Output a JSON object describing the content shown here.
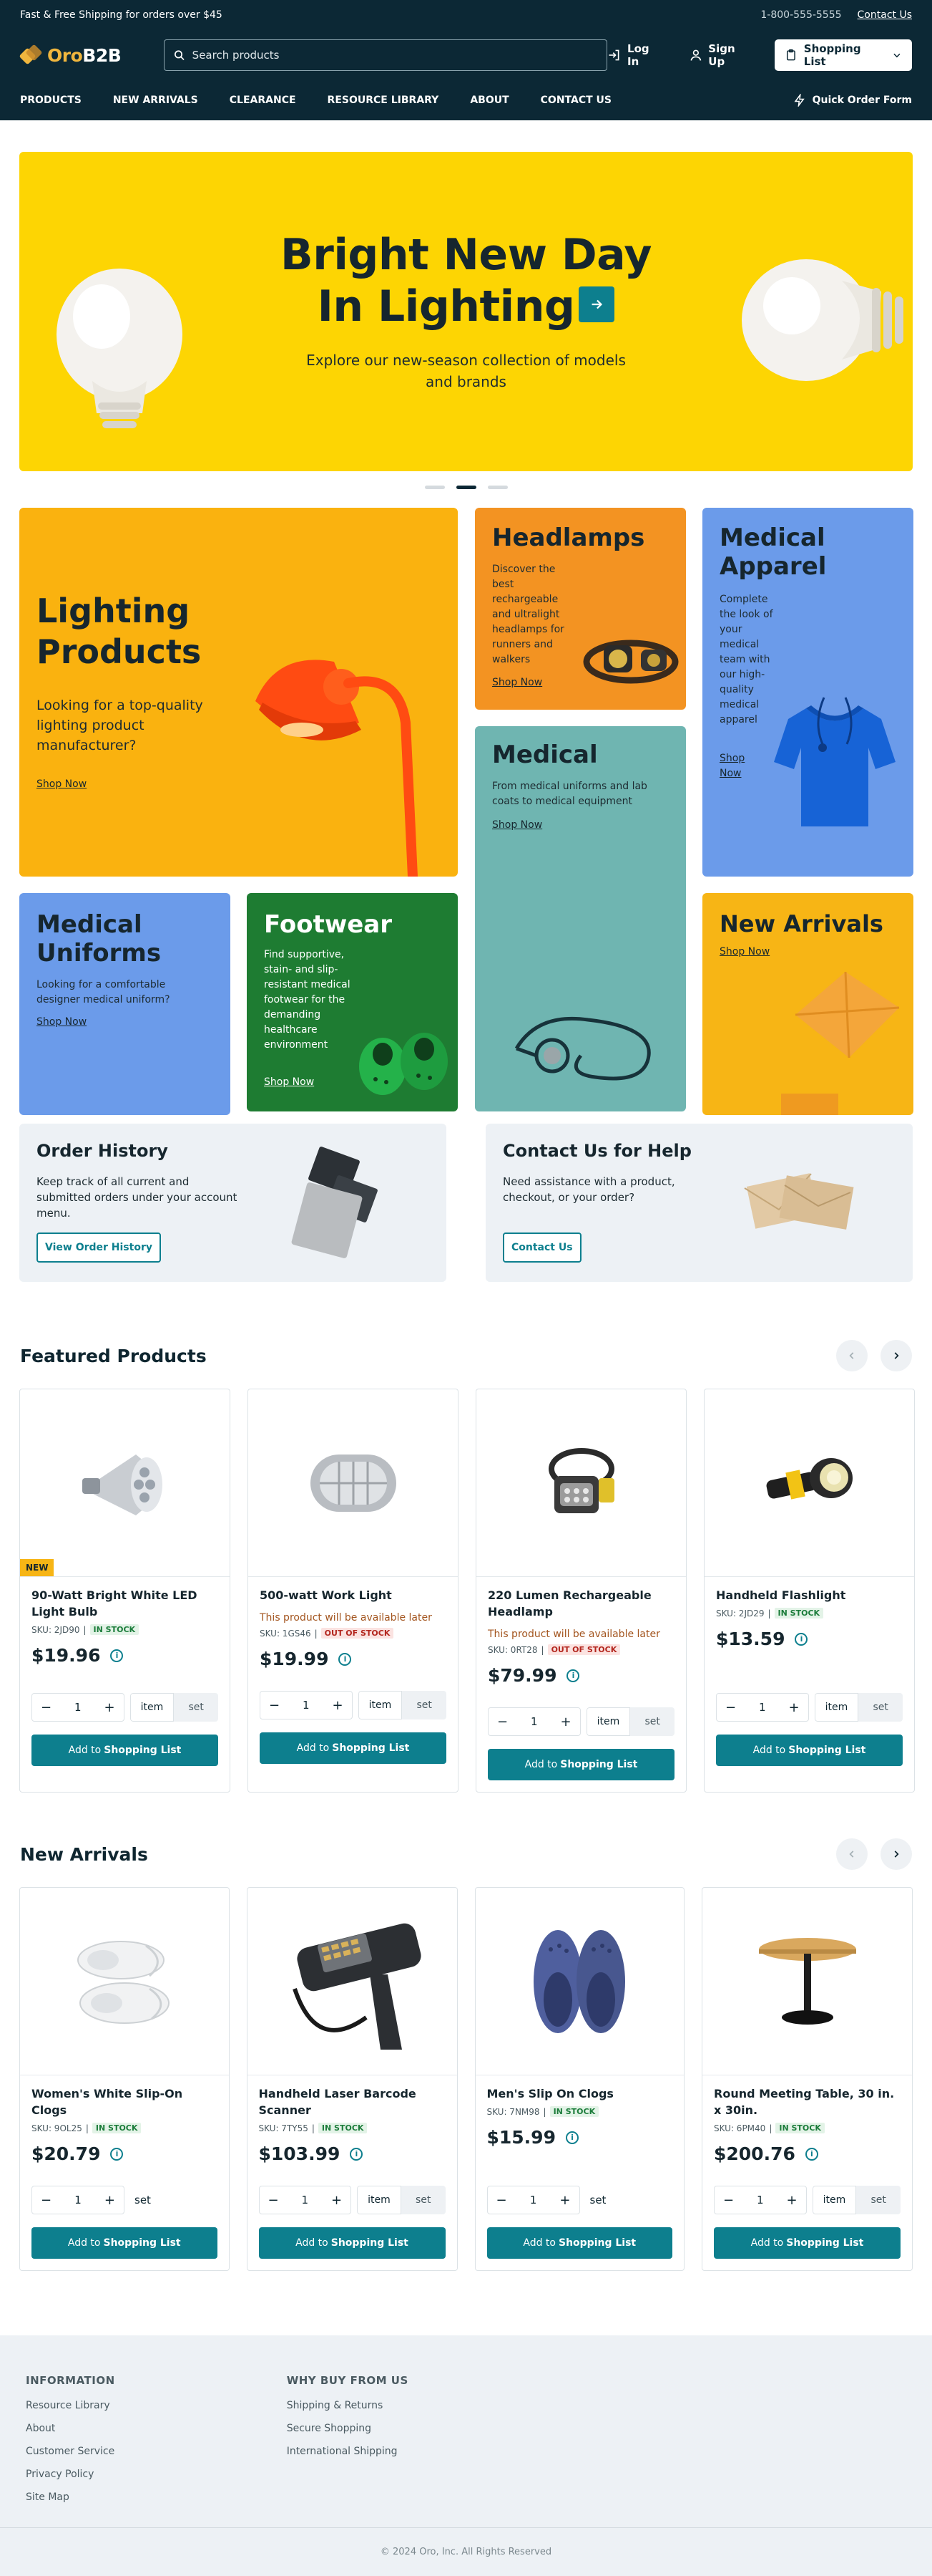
{
  "topbar": {
    "promo": "Fast & Free Shipping for orders over $45",
    "phone": "1-800-555-5555",
    "contact": "Contact Us"
  },
  "header": {
    "logo_prefix": "Oro",
    "logo_suffix": "B2B",
    "search_placeholder": "Search products",
    "login": "Log In",
    "signup": "Sign Up",
    "shopping_list": "Shopping List"
  },
  "nav": {
    "items": [
      "PRODUCTS",
      "NEW ARRIVALS",
      "CLEARANCE",
      "RESOURCE LIBRARY",
      "ABOUT",
      "CONTACT US"
    ],
    "quick_order": "Quick Order Form"
  },
  "hero": {
    "title_line1": "Bright New Day",
    "title_line2": "In Lighting",
    "subtitle_line1": "Explore our new-season collection of models",
    "subtitle_line2": "and brands"
  },
  "categories": {
    "lighting": {
      "title_line1": "Lighting",
      "title_line2": "Products",
      "text": "Looking for a top-quality lighting product manufacturer?",
      "cta": "Shop Now"
    },
    "headlamps": {
      "title": "Headlamps",
      "text": "Discover the best rechargeable and ultralight headlamps for runners and walkers",
      "cta": "Shop Now"
    },
    "medical_apparel": {
      "title_line1": "Medical",
      "title_line2": "Apparel",
      "text": "Complete the look of your medical team with our high-quality medical apparel",
      "cta": "Shop Now"
    },
    "medical": {
      "title": "Medical",
      "text": "From medical uniforms and lab coats to medical equipment",
      "cta": "Shop Now"
    },
    "medical_uniforms": {
      "title_line1": "Medical",
      "title_line2": "Uniforms",
      "text": "Looking for a comfortable designer medical uniform?",
      "cta": "Shop Now"
    },
    "footwear": {
      "title": "Footwear",
      "text": "Find supportive, stain- and slip-resistant medical footwear for the demanding healthcare environment",
      "cta": "Shop Now"
    },
    "new_arrivals": {
      "title": "New Arrivals",
      "cta": "Shop Now"
    }
  },
  "order_history": {
    "title": "Order History",
    "text": "Keep track of all current and submitted orders under your account menu.",
    "button": "View Order History"
  },
  "contact_help": {
    "title": "Contact Us for Help",
    "text": "Need assistance with a product, checkout, or your order?",
    "button": "Contact Us"
  },
  "featured": {
    "title": "Featured Products",
    "products": [
      {
        "name": "90-Watt Bright White LED Light Bulb",
        "sku": "SKU: 2JD90",
        "stock": "IN STOCK",
        "price": "$19.96",
        "availability": "",
        "badge": "NEW",
        "qty": "1",
        "unit1": "item",
        "unit2": "set"
      },
      {
        "name": "500-watt Work Light",
        "sku": "SKU: 1GS46",
        "stock": "OUT OF STOCK",
        "price": "$19.99",
        "availability": "This product will be available later",
        "badge": "",
        "qty": "1",
        "unit1": "item",
        "unit2": "set"
      },
      {
        "name": "220 Lumen Rechargeable Headlamp",
        "sku": "SKU: 0RT28",
        "stock": "OUT OF STOCK",
        "price": "$79.99",
        "availability": "This product will be available later",
        "badge": "",
        "qty": "1",
        "unit1": "item",
        "unit2": "set"
      },
      {
        "name": "Handheld Flashlight",
        "sku": "SKU: 2JD29",
        "stock": "IN STOCK",
        "price": "$13.59",
        "availability": "",
        "badge": "",
        "qty": "1",
        "unit1": "item",
        "unit2": "set"
      }
    ]
  },
  "arrivals": {
    "title": "New Arrivals",
    "products": [
      {
        "name": "Women's White Slip-On Clogs",
        "sku": "SKU: 9OL25",
        "stock": "IN STOCK",
        "price": "$20.79",
        "qty": "1",
        "unit1": "set",
        "unit2": ""
      },
      {
        "name": "Handheld Laser Barcode Scanner",
        "sku": "SKU: 7TY55",
        "stock": "IN STOCK",
        "price": "$103.99",
        "qty": "1",
        "unit1": "item",
        "unit2": "set"
      },
      {
        "name": "Men's Slip On Clogs",
        "sku": "SKU: 7NM98",
        "stock": "IN STOCK",
        "price": "$15.99",
        "qty": "1",
        "unit1": "set",
        "unit2": ""
      },
      {
        "name": "Round Meeting Table, 30 in. x 30in.",
        "sku": "SKU: 6PM40",
        "stock": "IN STOCK",
        "price": "$200.76",
        "qty": "1",
        "unit1": "item",
        "unit2": "set"
      }
    ]
  },
  "add_label_prefix": "Add to",
  "add_label_bold": "Shopping List",
  "footer": {
    "col1_title": "INFORMATION",
    "col1_links": [
      "Resource Library",
      "About",
      "Customer Service",
      "Privacy Policy",
      "Site Map"
    ],
    "col2_title": "WHY BUY FROM US",
    "col2_links": [
      "Shipping & Returns",
      "Secure Shopping",
      "International Shipping"
    ],
    "copyright": "© 2024 Oro, Inc. All Rights Reserved"
  },
  "colors": {
    "header_bg": "#0c2835",
    "accent_teal": "#0d7f8e",
    "hero_yellow": "#fdd503",
    "badge_orange": "#f7b515"
  }
}
